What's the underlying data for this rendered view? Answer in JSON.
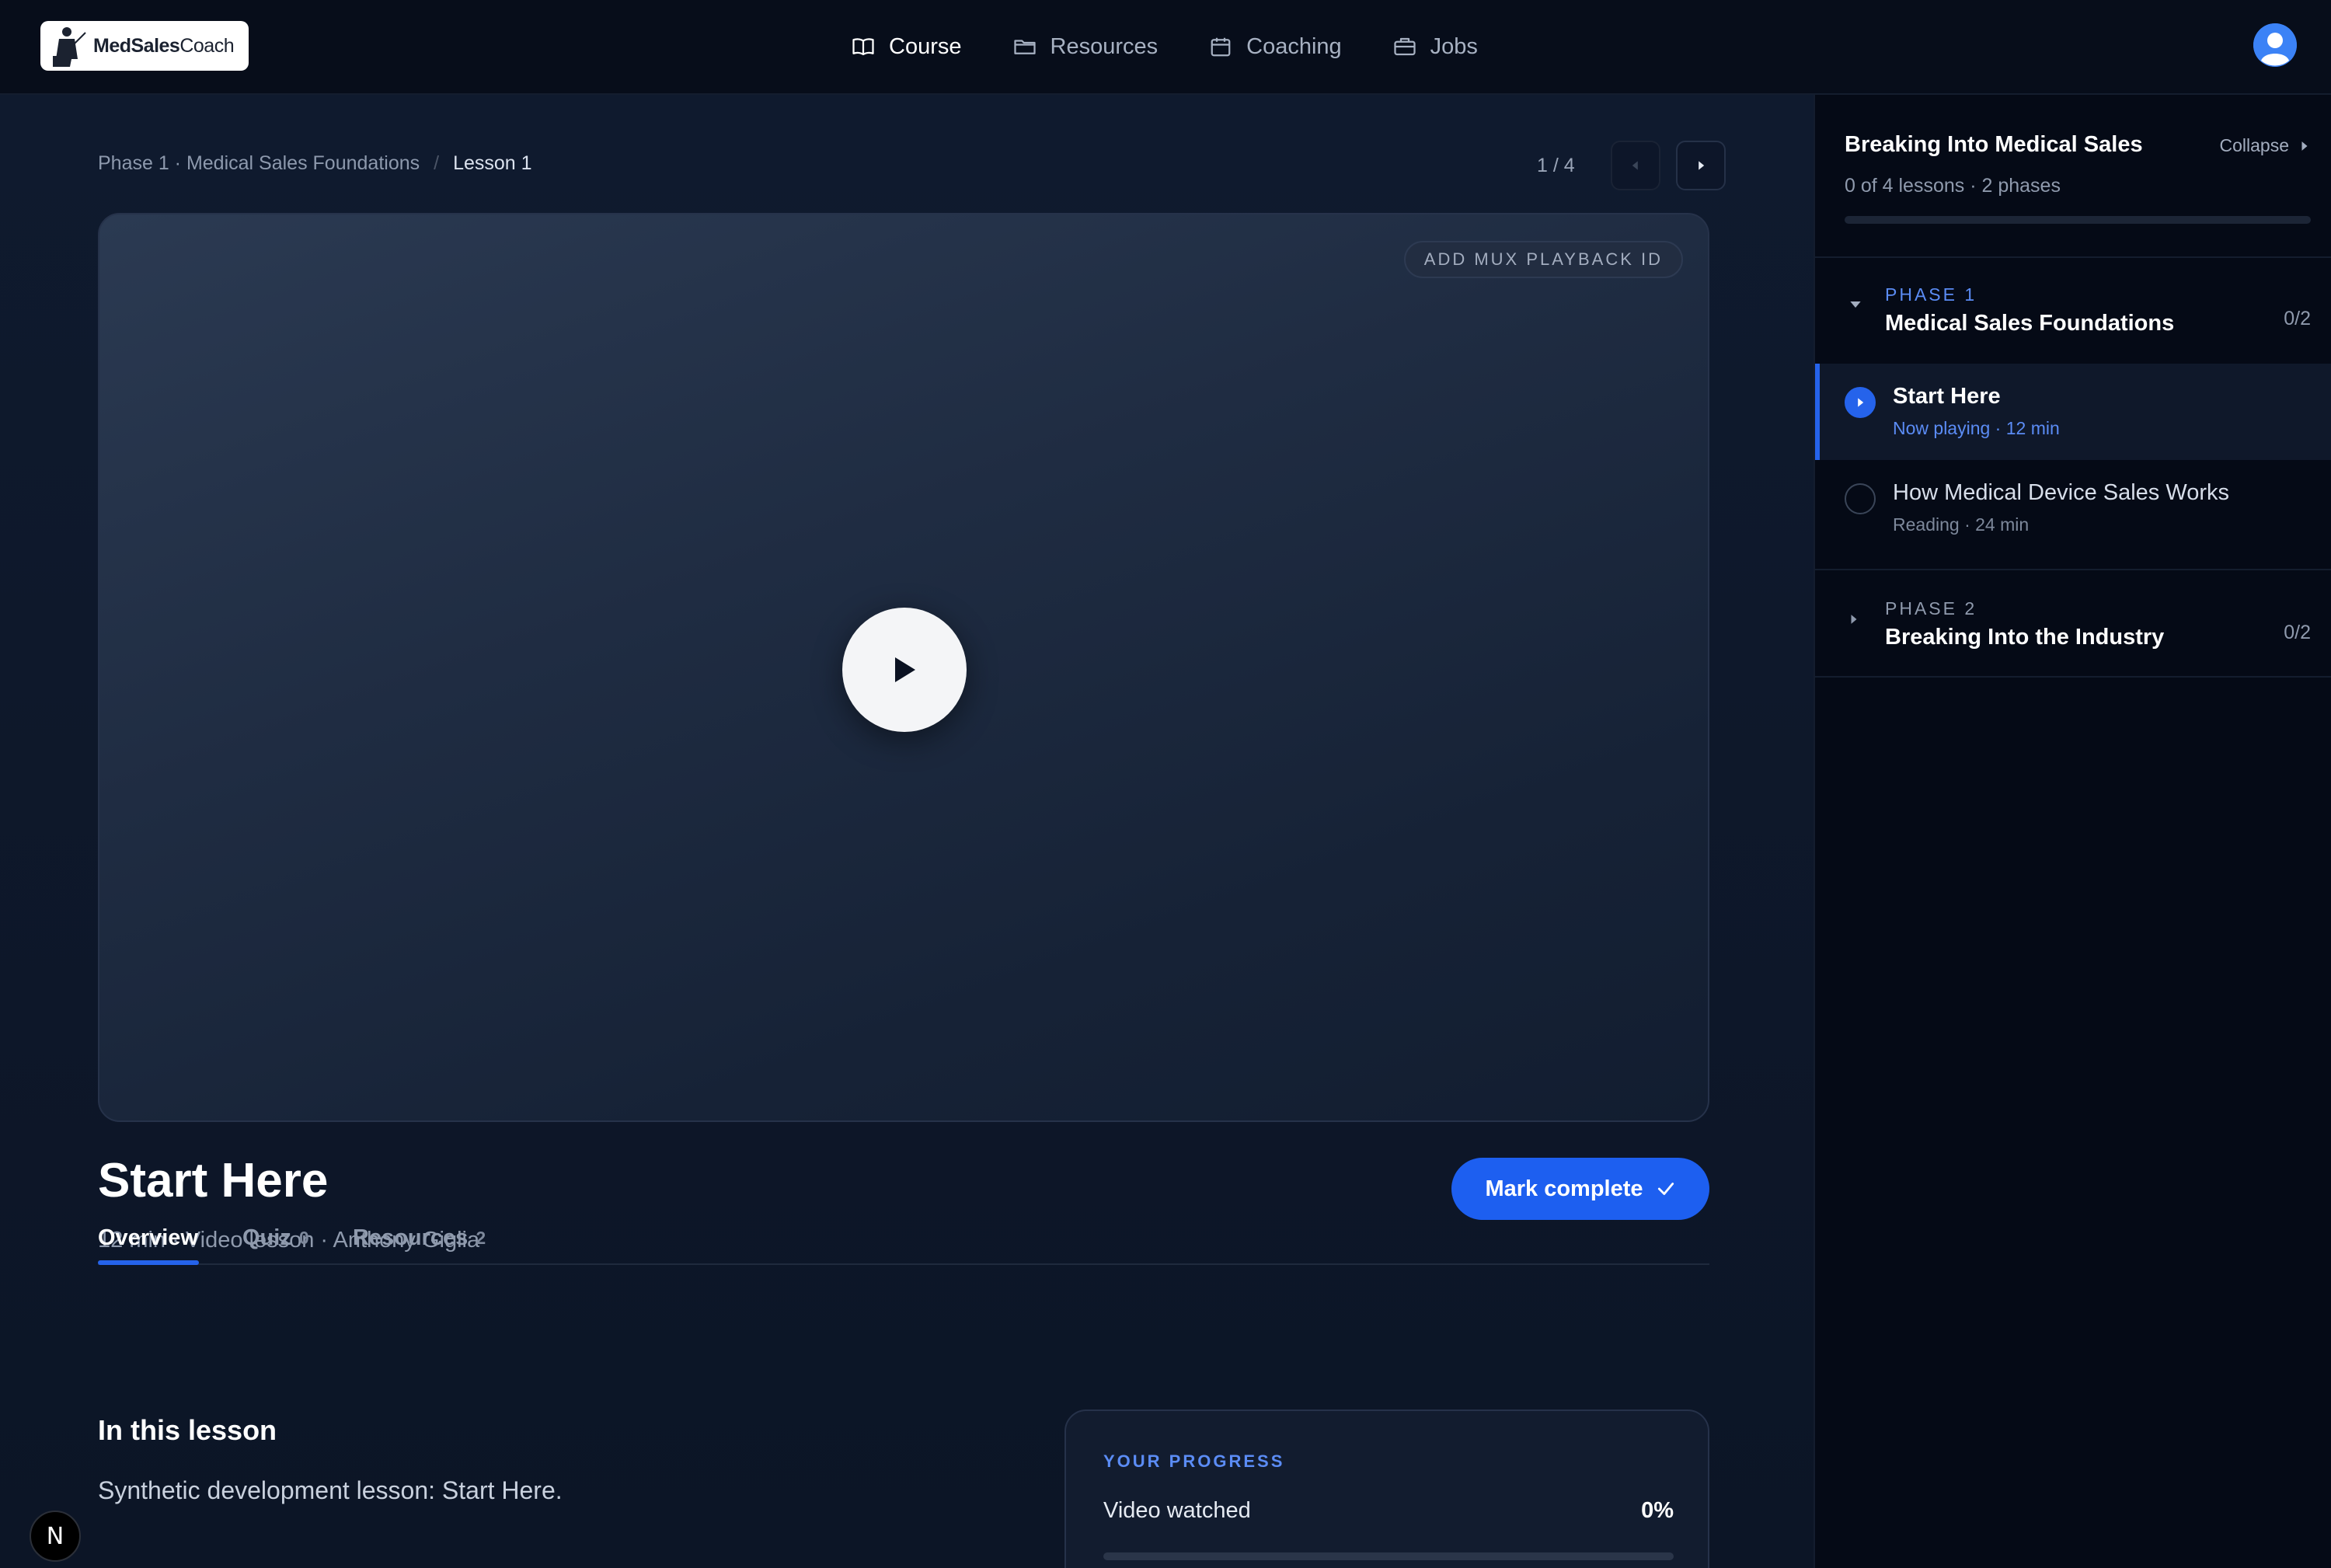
{
  "brand": {
    "logo_bold": "MedSales",
    "logo_light": "Coach"
  },
  "nav": {
    "items": [
      {
        "label": "Course",
        "icon": "book-icon",
        "active": true
      },
      {
        "label": "Resources",
        "icon": "folder-icon",
        "active": false
      },
      {
        "label": "Coaching",
        "icon": "calendar-icon",
        "active": false
      },
      {
        "label": "Jobs",
        "icon": "briefcase-icon",
        "active": false
      }
    ]
  },
  "breadcrumb": {
    "parent": "Phase 1 · Medical Sales Foundations",
    "separator": "/",
    "current": "Lesson 1"
  },
  "pager": {
    "count": "1 / 4"
  },
  "video": {
    "badge": "ADD MUX PLAYBACK ID"
  },
  "lesson": {
    "title": "Start Here",
    "meta": "12 min · Video lesson · Anthony Giglia",
    "mark_complete": "Mark complete"
  },
  "tabs": [
    {
      "label": "Overview",
      "count": ""
    },
    {
      "label": "Quiz",
      "count": "0"
    },
    {
      "label": "Resources",
      "count": "2"
    }
  ],
  "overview": {
    "heading": "In this lesson",
    "body": "Synthetic development lesson: Start Here."
  },
  "progress": {
    "label": "YOUR PROGRESS",
    "row_label": "Video watched",
    "value": "0%",
    "fraction": 0
  },
  "dev_badge": "N",
  "sidebar": {
    "title": "Breaking Into Medical Sales",
    "subtitle": "0 of 4 lessons · 2 phases",
    "collapse": "Collapse",
    "progress_fraction": 0,
    "phases": [
      {
        "label": "PHASE 1",
        "name": "Medical Sales Foundations",
        "count": "0/2",
        "expanded": true,
        "lessons": [
          {
            "name": "Start Here",
            "sub": "Now playing · 12 min",
            "active": true
          },
          {
            "name": "How Medical Device Sales Works",
            "sub": "Reading · 24 min",
            "active": false
          }
        ]
      },
      {
        "label": "PHASE 2",
        "name": "Breaking Into the Industry",
        "count": "0/2",
        "expanded": false,
        "lessons": []
      }
    ]
  },
  "colors": {
    "accent": "#2563eb",
    "accent_text": "#5b8cf5",
    "background": "#0b1222",
    "sidebar": "#050a16"
  }
}
